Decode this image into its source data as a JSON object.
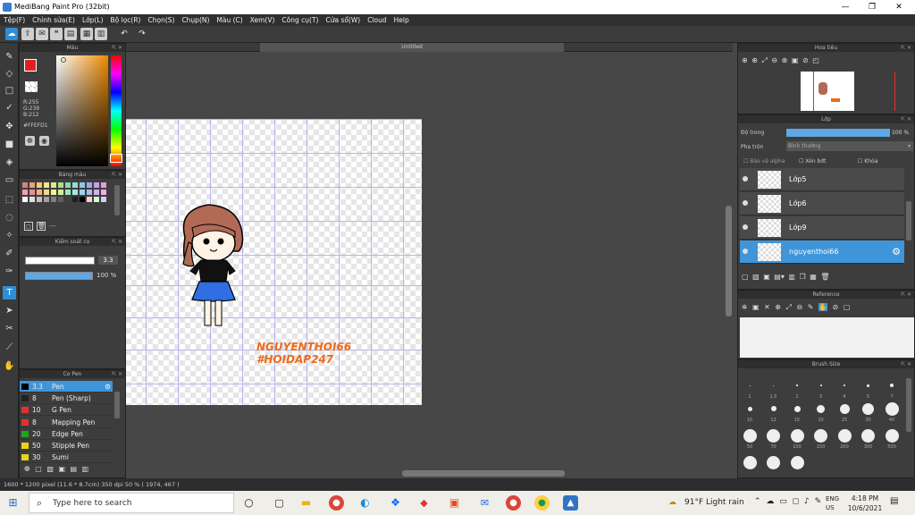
{
  "window": {
    "title": "MediBang Paint Pro (32bit)",
    "min": "—",
    "max": "❐",
    "close": "✕"
  },
  "menu": [
    "Tệp(F)",
    "Chỉnh sửa(E)",
    "Lớp(L)",
    "Bộ lọc(R)",
    "Chọn(S)",
    "Chụp(N)",
    "Màu (C)",
    "Xem(V)",
    "Công cụ(T)",
    "Cửa sổ(W)",
    "Cloud",
    "Help"
  ],
  "doc_tab": "Untitled",
  "panels": {
    "color": {
      "title": "Màu",
      "r": "R:255",
      "g": "G:239",
      "b": "B:212",
      "hex": "#FFEFD1"
    },
    "palette": {
      "title": "Bảng màu",
      "placeholder": "---"
    },
    "brush_control": {
      "title": "Kiểm soát cọ",
      "size": "3.3",
      "opacity": "100 %"
    },
    "brushes": {
      "title": "Cọ Pen",
      "items": [
        {
          "size": "3.3",
          "name": "Pen",
          "color": "#000000",
          "selected": true
        },
        {
          "size": "8",
          "name": "Pen (Sharp)",
          "color": "#222222",
          "selected": false
        },
        {
          "size": "10",
          "name": "G Pen",
          "color": "#e53030",
          "selected": false
        },
        {
          "size": "8",
          "name": "Mapping Pen",
          "color": "#e53030",
          "selected": false
        },
        {
          "size": "20",
          "name": "Edge Pen",
          "color": "#1fa51f",
          "selected": false
        },
        {
          "size": "50",
          "name": "Stipple Pen",
          "color": "#e8d21c",
          "selected": false
        },
        {
          "size": "30",
          "name": "Sumi",
          "color": "#e8d21c",
          "selected": false
        }
      ]
    },
    "navigator": {
      "title": "Hoa tiêu"
    },
    "layer": {
      "title": "Lớp",
      "opacity_label": "Độ trong",
      "opacity_value": "100 %",
      "blend_label": "Pha trộn",
      "blend_value": "Bình thường",
      "protect_alpha": "Bảo vệ alpha",
      "clipping": "Xén bớt",
      "lock": "Khóa",
      "items": [
        {
          "name": "Lớp5",
          "selected": false
        },
        {
          "name": "Lớp6",
          "selected": false
        },
        {
          "name": "Lớp9",
          "selected": false
        },
        {
          "name": "nguyenthoi66",
          "selected": true
        }
      ]
    },
    "reference": {
      "title": "Reference"
    },
    "brushsize": {
      "title": "Brush Size",
      "labels": [
        "1",
        "1.5",
        "2",
        "3",
        "4",
        "5",
        "7",
        "10",
        "12",
        "15",
        "20",
        "25",
        "30",
        "40",
        "50",
        "70",
        "100",
        "150",
        "200",
        "300",
        "500"
      ]
    }
  },
  "canvas": {
    "watermark1": "NGUYENTHOI66",
    "watermark2": "#HOIDAP247"
  },
  "status": "1600 * 1200 pixel  (11.6 * 8.7cm)  350 dpi  50 %  ( 1974, 467 )",
  "taskbar": {
    "search_placeholder": "Type here to search",
    "weather": "91°F  Light rain",
    "lang1": "ENG",
    "lang2": "US",
    "time": "4:18 PM",
    "date": "10/6/2021"
  },
  "colors": {
    "accent": "#3f95d9",
    "fg_color": "#e02020",
    "watermark": "#ef6a1c"
  }
}
